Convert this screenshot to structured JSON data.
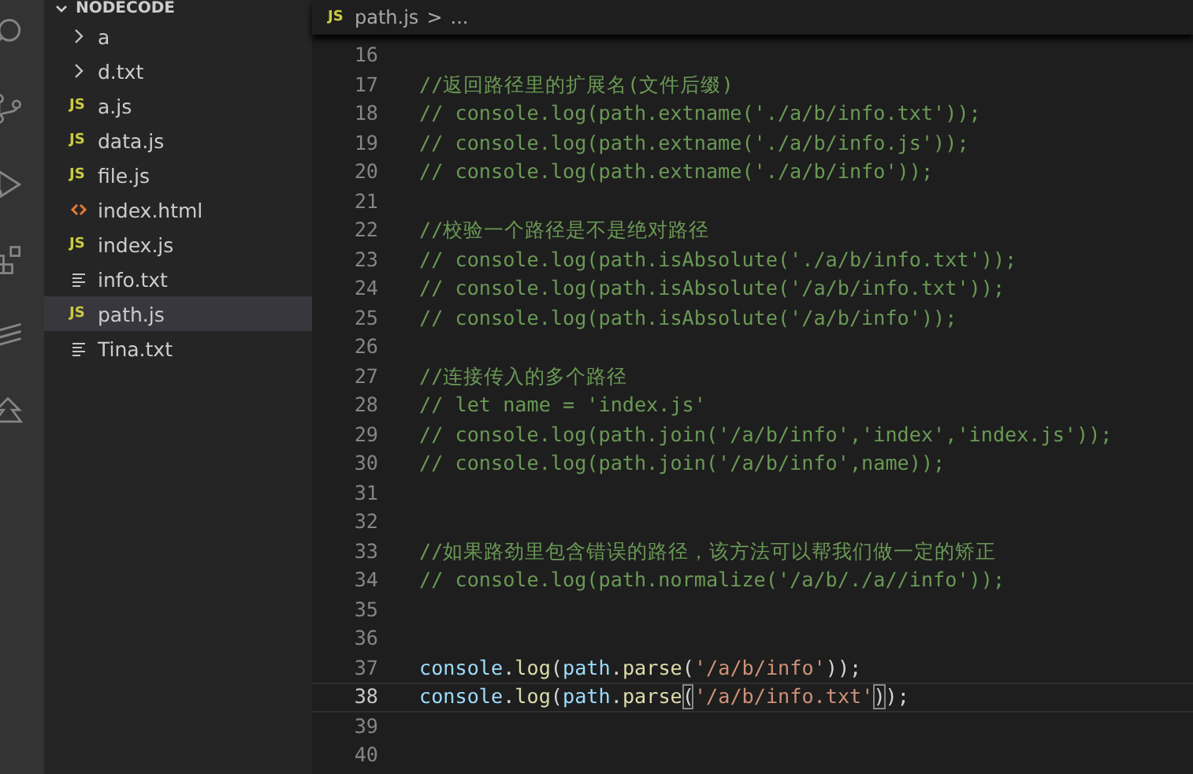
{
  "explorer": {
    "title": "NODECODE",
    "items": [
      {
        "kind": "folder",
        "label": "a",
        "selected": false
      },
      {
        "kind": "folder",
        "label": "d.txt",
        "selected": false
      },
      {
        "kind": "js",
        "badge": "JS",
        "label": "a.js",
        "selected": false
      },
      {
        "kind": "js",
        "badge": "JS",
        "label": "data.js",
        "selected": false
      },
      {
        "kind": "js",
        "badge": "JS",
        "label": "file.js",
        "selected": false
      },
      {
        "kind": "html",
        "label": "index.html",
        "selected": false
      },
      {
        "kind": "js",
        "badge": "JS",
        "label": "index.js",
        "selected": false
      },
      {
        "kind": "text",
        "label": "info.txt",
        "selected": false
      },
      {
        "kind": "js",
        "badge": "JS",
        "label": "path.js",
        "selected": true
      },
      {
        "kind": "text",
        "label": "Tina.txt",
        "selected": false
      }
    ]
  },
  "breadcrumb": {
    "badge": "JS",
    "file": "path.js",
    "separator": ">",
    "rest": "..."
  },
  "editor": {
    "lines": [
      {
        "number": "16",
        "current": false
      },
      {
        "number": "17",
        "current": false,
        "tokens": [
          {
            "kind": "comment",
            "text": "//返回路径里的扩展名(文件后缀)"
          }
        ]
      },
      {
        "number": "18",
        "current": false,
        "tokens": [
          {
            "kind": "comment",
            "text": "// console.log(path.extname('./a/b/info.txt'));"
          }
        ]
      },
      {
        "number": "19",
        "current": false,
        "tokens": [
          {
            "kind": "comment",
            "text": "// console.log(path.extname('./a/b/info.js'));"
          }
        ]
      },
      {
        "number": "20",
        "current": false,
        "tokens": [
          {
            "kind": "comment",
            "text": "// console.log(path.extname('./a/b/info'));"
          }
        ]
      },
      {
        "number": "21",
        "current": false
      },
      {
        "number": "22",
        "current": false,
        "tokens": [
          {
            "kind": "comment",
            "text": "//校验一个路径是不是绝对路径"
          }
        ]
      },
      {
        "number": "23",
        "current": false,
        "tokens": [
          {
            "kind": "comment",
            "text": "// console.log(path.isAbsolute('./a/b/info.txt'));"
          }
        ]
      },
      {
        "number": "24",
        "current": false,
        "tokens": [
          {
            "kind": "comment",
            "text": "// console.log(path.isAbsolute('/a/b/info.txt'));"
          }
        ]
      },
      {
        "number": "25",
        "current": false,
        "tokens": [
          {
            "kind": "comment",
            "text": "// console.log(path.isAbsolute('/a/b/info'));"
          }
        ]
      },
      {
        "number": "26",
        "current": false
      },
      {
        "number": "27",
        "current": false,
        "tokens": [
          {
            "kind": "comment",
            "text": "//连接传入的多个路径"
          }
        ]
      },
      {
        "number": "28",
        "current": false,
        "tokens": [
          {
            "kind": "comment",
            "text": "// let name = 'index.js'"
          }
        ]
      },
      {
        "number": "29",
        "current": false,
        "tokens": [
          {
            "kind": "comment",
            "text": "// console.log(path.join('/a/b/info','index','index.js'));"
          }
        ]
      },
      {
        "number": "30",
        "current": false,
        "tokens": [
          {
            "kind": "comment",
            "text": "// console.log(path.join('/a/b/info',name));"
          }
        ]
      },
      {
        "number": "31",
        "current": false
      },
      {
        "number": "32",
        "current": false
      },
      {
        "number": "33",
        "current": false,
        "tokens": [
          {
            "kind": "comment",
            "text": "//如果路劲里包含错误的路径，该方法可以帮我们做一定的矫正"
          }
        ]
      },
      {
        "number": "34",
        "current": false,
        "tokens": [
          {
            "kind": "comment",
            "text": "// console.log(path.normalize('/a/b/./a//info'));"
          }
        ]
      },
      {
        "number": "35",
        "current": false
      },
      {
        "number": "36",
        "current": false
      },
      {
        "number": "37",
        "current": false,
        "tokens": [
          {
            "kind": "variable",
            "text": "console"
          },
          {
            "kind": "punct",
            "text": "."
          },
          {
            "kind": "function",
            "text": "log"
          },
          {
            "kind": "punct",
            "text": "("
          },
          {
            "kind": "variable",
            "text": "path"
          },
          {
            "kind": "punct",
            "text": "."
          },
          {
            "kind": "function",
            "text": "parse"
          },
          {
            "kind": "punct",
            "text": "("
          },
          {
            "kind": "string",
            "text": "'/a/b/info'"
          },
          {
            "kind": "punct",
            "text": "));"
          }
        ]
      },
      {
        "number": "38",
        "current": true,
        "tokens": [
          {
            "kind": "variable",
            "text": "console"
          },
          {
            "kind": "punct",
            "text": "."
          },
          {
            "kind": "function",
            "text": "log"
          },
          {
            "kind": "punct",
            "text": "("
          },
          {
            "kind": "variable",
            "text": "path"
          },
          {
            "kind": "punct",
            "text": "."
          },
          {
            "kind": "function",
            "text": "parse"
          },
          {
            "kind": "bracket-match",
            "text": "("
          },
          {
            "kind": "string",
            "text": "'/a/b/info.txt'"
          },
          {
            "kind": "bracket-match",
            "text": ")"
          },
          {
            "kind": "punct",
            "text": ");"
          }
        ]
      },
      {
        "number": "39",
        "current": false
      },
      {
        "number": "40",
        "current": false
      }
    ]
  }
}
